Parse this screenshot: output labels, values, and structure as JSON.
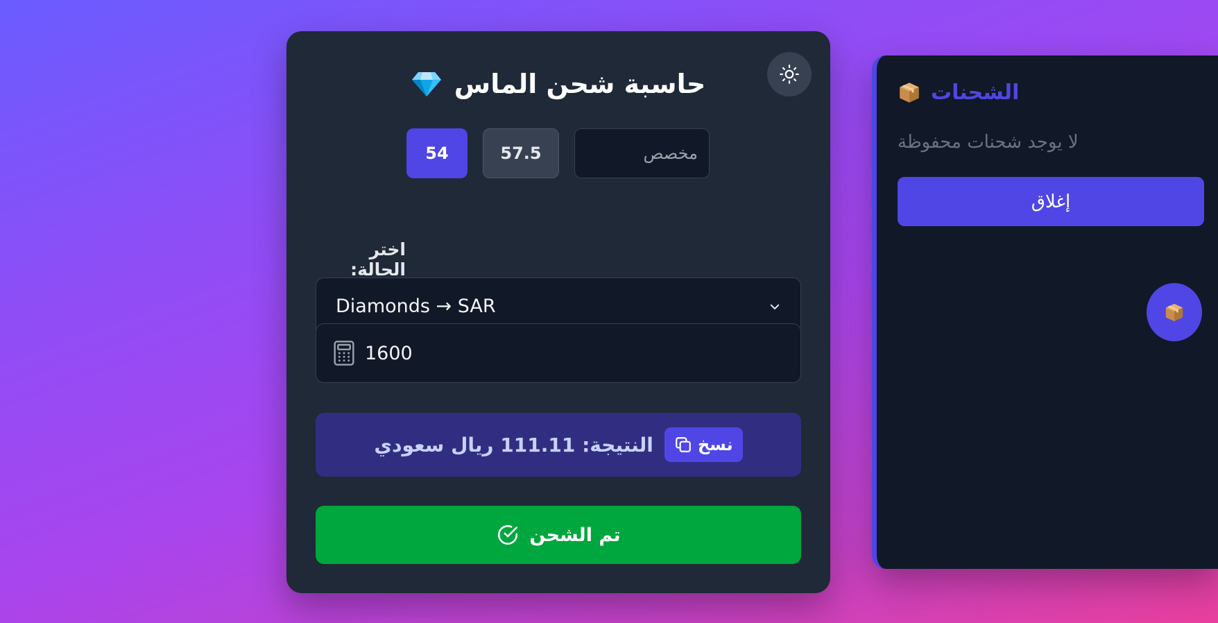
{
  "calculator": {
    "title": "حاسبة شحن الماس",
    "title_icon": "diamond-icon",
    "theme_toggle_icon": "sun-icon",
    "rates": [
      {
        "label": "54",
        "active": true
      },
      {
        "label": "57.5",
        "active": false
      }
    ],
    "custom_rate": {
      "value": "",
      "placeholder": "مخصص"
    },
    "state_label": "اختر الحالة:",
    "state_select": {
      "value": "Diamonds → SAR"
    },
    "amount": {
      "value": "1600",
      "icon": "calculator-icon"
    },
    "result": {
      "text": "النتيجة: 111.11 ريال سعودي",
      "copy_label": "نسخ",
      "copy_icon": "copy-icon"
    },
    "done_button": {
      "label": "تم الشحن",
      "icon": "check-circle-icon"
    }
  },
  "shipments_panel": {
    "title": "الشحنات",
    "title_icon": "package-icon",
    "empty_text": "لا يوجد شحنات محفوظة",
    "close_label": "إغلاق",
    "fab_icon": "package-icon"
  },
  "colors": {
    "accent": "#4f46e5",
    "success": "#00a63e",
    "card_bg": "#1f2937",
    "panel_bg": "#111827",
    "result_bg": "#312e81"
  }
}
